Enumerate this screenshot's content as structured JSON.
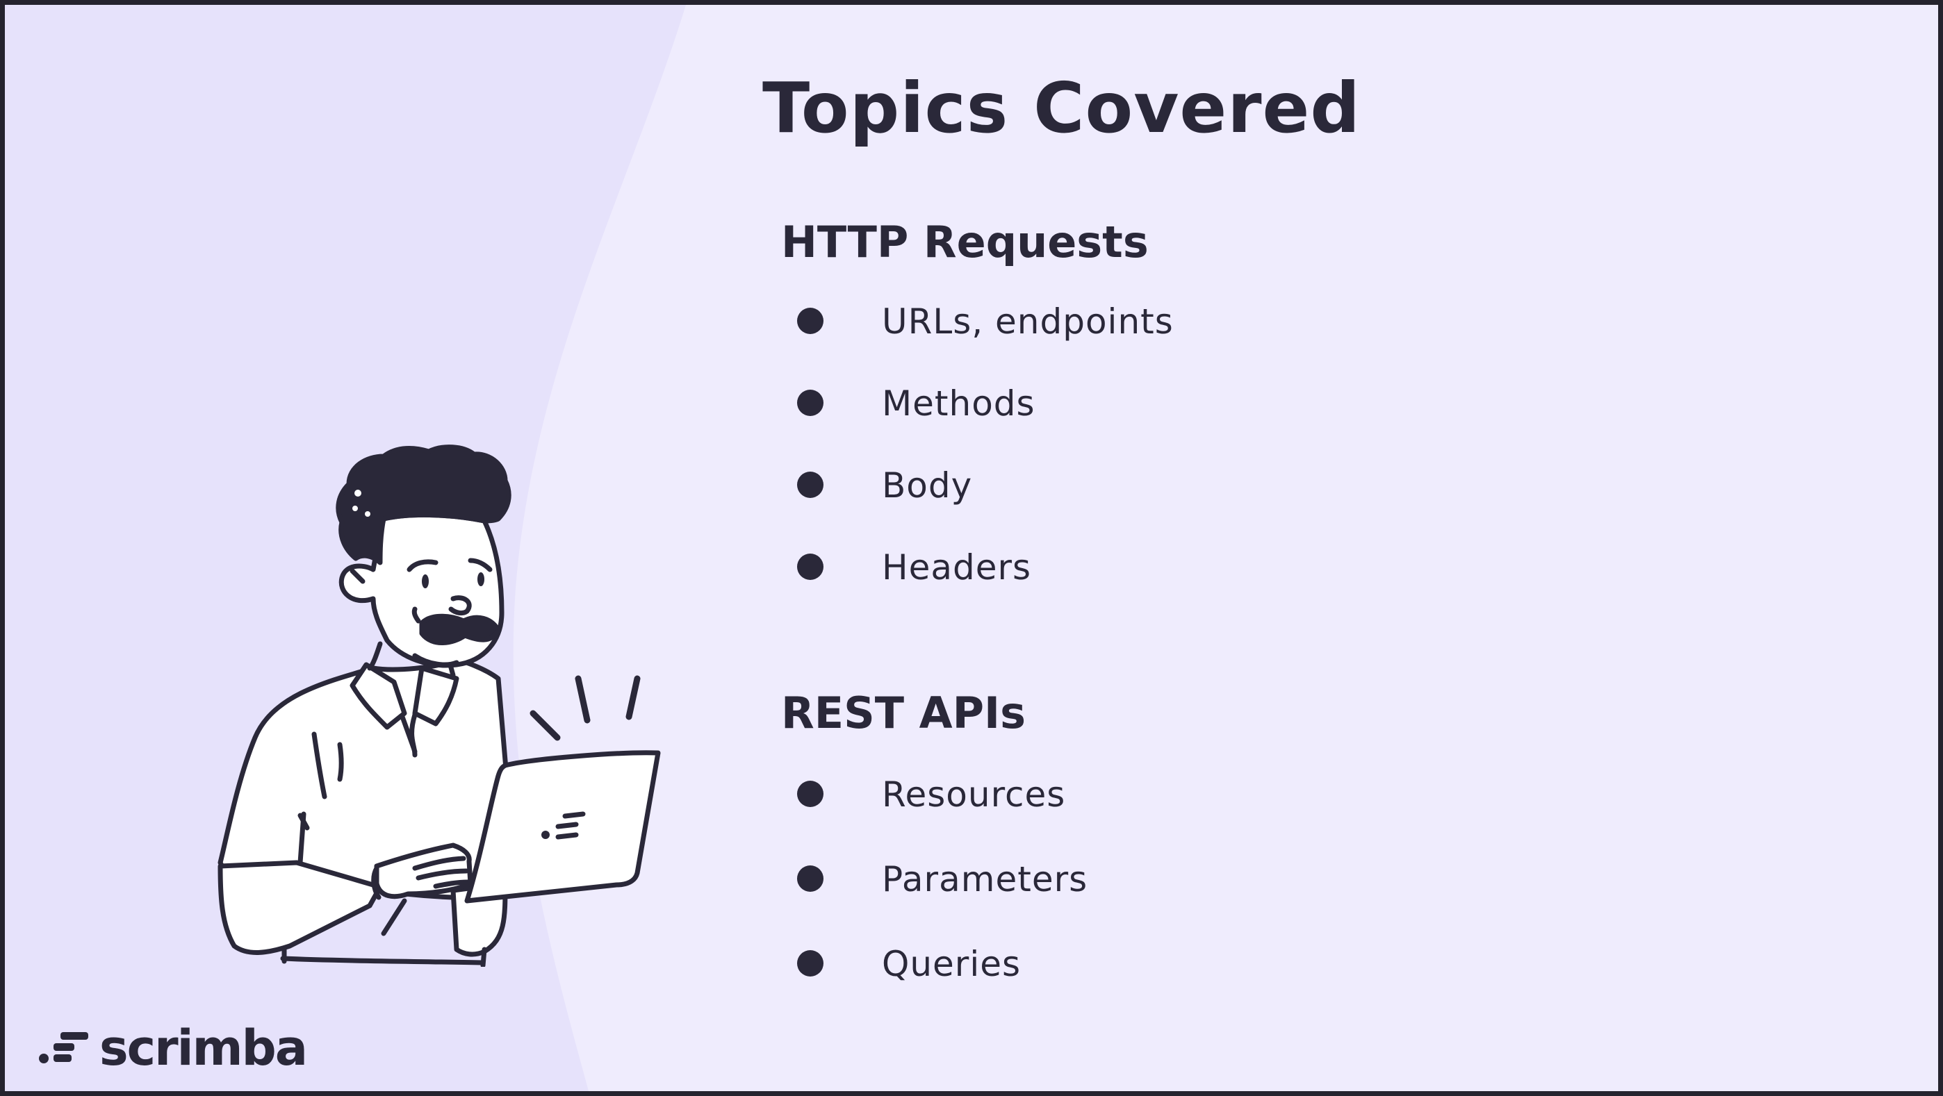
{
  "slide": {
    "title": "Topics Covered",
    "sections": [
      {
        "heading": "HTTP Requests",
        "items": [
          "URLs, endpoints",
          "Methods",
          "Body",
          "Headers"
        ]
      },
      {
        "heading": "REST APIs",
        "items": [
          "Resources",
          "Parameters",
          "Queries"
        ]
      }
    ]
  },
  "branding": {
    "logo_text": "scrimba",
    "logo_icon": "scrimba-logo-icon"
  },
  "illustration": {
    "icon": "person-with-laptop-illustration"
  },
  "colors": {
    "background": "#efecfd",
    "left_panel": "#e6e2fb",
    "text": "#2a2839",
    "frame": "#25232e"
  }
}
